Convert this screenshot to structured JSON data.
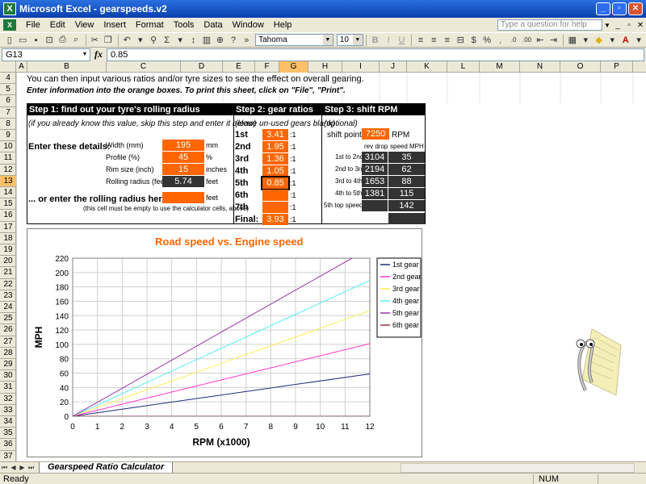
{
  "window": {
    "title": "Microsoft Excel - gearspeeds.v2",
    "app_icon_label": "X"
  },
  "menu": {
    "items": [
      "File",
      "Edit",
      "View",
      "Insert",
      "Format",
      "Tools",
      "Data",
      "Window",
      "Help"
    ],
    "help_placeholder": "Type a question for help"
  },
  "toolbar": {
    "font_name": "Tahoma",
    "font_size": "10"
  },
  "formula_bar": {
    "name_box": "G13",
    "fx_label": "fx",
    "formula": "0.85"
  },
  "columns": [
    "A",
    "B",
    "C",
    "D",
    "E",
    "F",
    "G",
    "H",
    "I",
    "J",
    "K",
    "L",
    "M",
    "N",
    "O",
    "P"
  ],
  "selected_column": "G",
  "rows": [
    "4",
    "5",
    "6",
    "7",
    "8",
    "9",
    "10",
    "11",
    "12",
    "13",
    "14",
    "15",
    "16",
    "17",
    "18",
    "19",
    "20",
    "21",
    "22",
    "23",
    "24",
    "25",
    "26",
    "27",
    "28",
    "29",
    "30",
    "31",
    "32",
    "33",
    "34",
    "35",
    "36",
    "37"
  ],
  "selected_row": "13",
  "intro": {
    "line1": "You can then input various ratios and/or tyre sizes to see the effect on overall gearing.",
    "line2": "Enter information into the orange boxes. To print this sheet, click on \"File\", \"Print\"."
  },
  "step1": {
    "header": "Step 1: find out your tyre's rolling radius",
    "note": "(if you already know this value, skip this step and enter it below)",
    "enter_label": "Enter these details:",
    "fields": [
      {
        "label": "Width (mm)",
        "value": "195",
        "unit": "mm"
      },
      {
        "label": "Profile (%)",
        "value": "45",
        "unit": "%"
      },
      {
        "label": "Rim size (inch)",
        "value": "15",
        "unit": "inches"
      },
      {
        "label": "Rolling radius (feet)",
        "value": "5.74",
        "unit": "feet"
      }
    ],
    "or_label": "... or enter the rolling radius here:",
    "or_unit": "feet",
    "or_note": "(this cell must be empty to use the calculator cells, above)"
  },
  "step2": {
    "header": "Step 2: gear ratios",
    "note": "(leave un-used gears blank)",
    "ratio_suffix": ":1",
    "gears": [
      {
        "label": "1st",
        "value": "3.41"
      },
      {
        "label": "2nd",
        "value": "1.95"
      },
      {
        "label": "3rd",
        "value": "1.36"
      },
      {
        "label": "4th",
        "value": "1.05"
      },
      {
        "label": "5th",
        "value": "0.85"
      },
      {
        "label": "6th",
        "value": ""
      },
      {
        "label": "7th",
        "value": ""
      },
      {
        "label": "Final:",
        "value": "3.93"
      }
    ]
  },
  "step3": {
    "header": "Step 3: shift RPM",
    "note": "(optional)",
    "shift_label": "shift point:",
    "shift_value": "7250",
    "shift_unit": "RPM",
    "col_rev": "rev drop",
    "col_speed": "speed MPH",
    "rows": [
      {
        "label": "1st to 2nd",
        "rev": "3104",
        "speed": "35"
      },
      {
        "label": "2nd to 3rd",
        "rev": "2194",
        "speed": "62"
      },
      {
        "label": "3rd to 4th",
        "rev": "1653",
        "speed": "88"
      },
      {
        "label": "4th to 5th",
        "rev": "1381",
        "speed": "115"
      },
      {
        "label": "5th top speed",
        "rev": "",
        "speed": "142"
      }
    ]
  },
  "chart_data": {
    "type": "line",
    "title": "Road speed vs. Engine speed",
    "xlabel": "RPM (x1000)",
    "ylabel": "MPH",
    "xlim": [
      0,
      12
    ],
    "ylim": [
      0,
      220
    ],
    "x_ticks": [
      0,
      1,
      2,
      3,
      4,
      5,
      6,
      7,
      8,
      9,
      10,
      11,
      12
    ],
    "y_ticks": [
      0,
      20,
      40,
      60,
      80,
      100,
      120,
      140,
      160,
      180,
      200,
      220
    ],
    "grid": true,
    "legend": "right",
    "series": [
      {
        "name": "1st gear",
        "color": "#1f2a7a",
        "x": [
          0,
          12
        ],
        "values": [
          0,
          59
        ]
      },
      {
        "name": "2nd gear",
        "color": "#ff33cc",
        "x": [
          0,
          12
        ],
        "values": [
          0,
          101
        ]
      },
      {
        "name": "3rd gear",
        "color": "#ffee55",
        "x": [
          0,
          12
        ],
        "values": [
          0,
          147
        ]
      },
      {
        "name": "4th gear",
        "color": "#55eeee",
        "x": [
          0,
          12
        ],
        "values": [
          0,
          189
        ]
      },
      {
        "name": "5th gear",
        "color": "#9933aa",
        "x": [
          0,
          12
        ],
        "values": [
          0,
          234
        ]
      },
      {
        "name": "6th gear",
        "color": "#993344",
        "x": [
          0,
          12
        ],
        "values": [
          0,
          0
        ]
      }
    ]
  },
  "sheet_tab": "Gearspeed Ratio Calculator",
  "status": {
    "left": "Ready",
    "num": "NUM"
  }
}
